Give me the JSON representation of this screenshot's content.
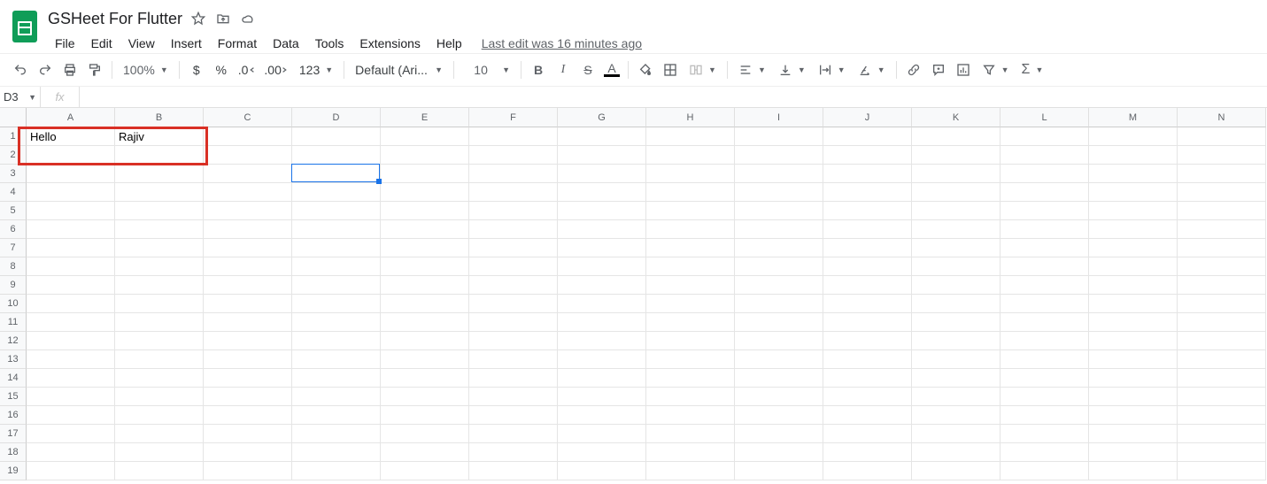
{
  "title": "GSHeet For Flutter",
  "menus": [
    "File",
    "Edit",
    "View",
    "Insert",
    "Format",
    "Data",
    "Tools",
    "Extensions",
    "Help"
  ],
  "last_edit": "Last edit was 16 minutes ago",
  "toolbar": {
    "zoom": "100%",
    "font_name": "Default (Ari...",
    "font_size": "10"
  },
  "name_box": "D3",
  "fx_label": "fx",
  "columns": [
    "A",
    "B",
    "C",
    "D",
    "E",
    "F",
    "G",
    "H",
    "I",
    "J",
    "K",
    "L",
    "M",
    "N"
  ],
  "row_count": 19,
  "cells": {
    "A1": "Hello",
    "B1": "Rajiv"
  },
  "selected_cell": {
    "col_index": 3,
    "row_index": 2
  },
  "highlight_box": {
    "col_start": 0,
    "row_start": 0,
    "col_end": 1,
    "row_end": 1
  }
}
